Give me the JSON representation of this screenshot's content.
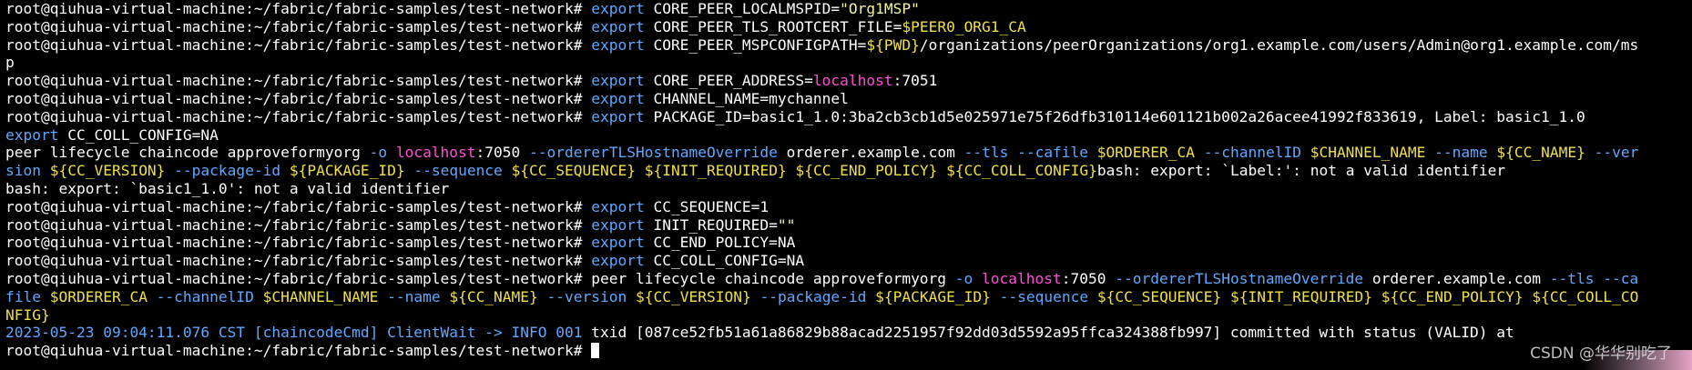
{
  "colors": {
    "default": "#ffffff",
    "cmd": "#5fa8ff",
    "string": "#f5f5a0",
    "var": "#f0e040",
    "host": "#ff4fd8",
    "background": "#000000"
  },
  "prompt": "root@qiuhua-virtual-machine:~/fabric/fabric-samples/test-network# ",
  "lines": [
    [
      {
        "t": "root@qiuhua-virtual-machine:~/fabric/fabric-samples/test-network# ",
        "c": "default"
      },
      {
        "t": "export",
        "c": "cmd"
      },
      {
        "t": " CORE_PEER_LOCALMSPID=",
        "c": "default"
      },
      {
        "t": "\"Org1MSP\"",
        "c": "string"
      }
    ],
    [
      {
        "t": "root@qiuhua-virtual-machine:~/fabric/fabric-samples/test-network# ",
        "c": "default"
      },
      {
        "t": "export",
        "c": "cmd"
      },
      {
        "t": " CORE_PEER_TLS_ROOTCERT_FILE=",
        "c": "default"
      },
      {
        "t": "$PEER0_ORG1_CA",
        "c": "var"
      }
    ],
    [
      {
        "t": "root@qiuhua-virtual-machine:~/fabric/fabric-samples/test-network# ",
        "c": "default"
      },
      {
        "t": "export",
        "c": "cmd"
      },
      {
        "t": " CORE_PEER_MSPCONFIGPATH=",
        "c": "default"
      },
      {
        "t": "${PWD}",
        "c": "var"
      },
      {
        "t": "/organizations/peerOrganizations/org1.example.com/users/Admin@org1.example.com/ms",
        "c": "default"
      }
    ],
    [
      {
        "t": "p",
        "c": "default"
      }
    ],
    [
      {
        "t": "root@qiuhua-virtual-machine:~/fabric/fabric-samples/test-network# ",
        "c": "default"
      },
      {
        "t": "export",
        "c": "cmd"
      },
      {
        "t": " CORE_PEER_ADDRESS=",
        "c": "default"
      },
      {
        "t": "localhost",
        "c": "host"
      },
      {
        "t": ":7051",
        "c": "default"
      }
    ],
    [
      {
        "t": "root@qiuhua-virtual-machine:~/fabric/fabric-samples/test-network# ",
        "c": "default"
      },
      {
        "t": "export",
        "c": "cmd"
      },
      {
        "t": " CHANNEL_NAME=mychannel",
        "c": "default"
      }
    ],
    [
      {
        "t": "root@qiuhua-virtual-machine:~/fabric/fabric-samples/test-network# ",
        "c": "default"
      },
      {
        "t": "export",
        "c": "cmd"
      },
      {
        "t": " PACKAGE_ID=basic1_1.0:3ba2cb3cb1d5e025971e75f26dfb310114e601121b002a26acee41992f833619, Label: basic1_1.0",
        "c": "default"
      }
    ],
    [
      {
        "t": "export",
        "c": "cmd"
      },
      {
        "t": " CC_COLL_CONFIG=NA",
        "c": "default"
      }
    ],
    [
      {
        "t": "peer lifecycle chaincode approveformyorg ",
        "c": "default"
      },
      {
        "t": "-o",
        "c": "cmd"
      },
      {
        "t": " ",
        "c": "default"
      },
      {
        "t": "localhost",
        "c": "host"
      },
      {
        "t": ":7050 ",
        "c": "default"
      },
      {
        "t": "--ordererTLSHostnameOverride",
        "c": "cmd"
      },
      {
        "t": " orderer.example.com ",
        "c": "default"
      },
      {
        "t": "--tls",
        "c": "cmd"
      },
      {
        "t": " ",
        "c": "default"
      },
      {
        "t": "--cafile",
        "c": "cmd"
      },
      {
        "t": " ",
        "c": "default"
      },
      {
        "t": "$ORDERER_CA",
        "c": "var"
      },
      {
        "t": " ",
        "c": "default"
      },
      {
        "t": "--channelID",
        "c": "cmd"
      },
      {
        "t": " ",
        "c": "default"
      },
      {
        "t": "$CHANNEL_NAME",
        "c": "var"
      },
      {
        "t": " ",
        "c": "default"
      },
      {
        "t": "--name",
        "c": "cmd"
      },
      {
        "t": " ",
        "c": "default"
      },
      {
        "t": "${CC_NAME}",
        "c": "var"
      },
      {
        "t": " ",
        "c": "default"
      },
      {
        "t": "--ver",
        "c": "cmd"
      }
    ],
    [
      {
        "t": "sion",
        "c": "cmd"
      },
      {
        "t": " ",
        "c": "default"
      },
      {
        "t": "${CC_VERSION}",
        "c": "var"
      },
      {
        "t": " ",
        "c": "default"
      },
      {
        "t": "--package-id",
        "c": "cmd"
      },
      {
        "t": " ",
        "c": "default"
      },
      {
        "t": "${PACKAGE_ID}",
        "c": "var"
      },
      {
        "t": " ",
        "c": "default"
      },
      {
        "t": "--sequence",
        "c": "cmd"
      },
      {
        "t": " ",
        "c": "default"
      },
      {
        "t": "${CC_SEQUENCE}",
        "c": "var"
      },
      {
        "t": " ",
        "c": "default"
      },
      {
        "t": "${INIT_REQUIRED}",
        "c": "var"
      },
      {
        "t": " ",
        "c": "default"
      },
      {
        "t": "${CC_END_POLICY}",
        "c": "var"
      },
      {
        "t": " ",
        "c": "default"
      },
      {
        "t": "${CC_COLL_CONFIG}",
        "c": "var"
      },
      {
        "t": "bash: export: `Label:': not a valid identifier",
        "c": "default"
      }
    ],
    [
      {
        "t": "bash: export: `basic1_1.0': not a valid identifier",
        "c": "default"
      }
    ],
    [
      {
        "t": "root@qiuhua-virtual-machine:~/fabric/fabric-samples/test-network# ",
        "c": "default"
      },
      {
        "t": "export",
        "c": "cmd"
      },
      {
        "t": " CC_SEQUENCE=1",
        "c": "default"
      }
    ],
    [
      {
        "t": "root@qiuhua-virtual-machine:~/fabric/fabric-samples/test-network# ",
        "c": "default"
      },
      {
        "t": "export",
        "c": "cmd"
      },
      {
        "t": " INIT_REQUIRED=",
        "c": "default"
      },
      {
        "t": "\"\"",
        "c": "string"
      }
    ],
    [
      {
        "t": "root@qiuhua-virtual-machine:~/fabric/fabric-samples/test-network# ",
        "c": "default"
      },
      {
        "t": "export",
        "c": "cmd"
      },
      {
        "t": " CC_END_POLICY=NA",
        "c": "default"
      }
    ],
    [
      {
        "t": "root@qiuhua-virtual-machine:~/fabric/fabric-samples/test-network# ",
        "c": "default"
      },
      {
        "t": "export",
        "c": "cmd"
      },
      {
        "t": " CC_COLL_CONFIG=NA",
        "c": "default"
      }
    ],
    [
      {
        "t": "root@qiuhua-virtual-machine:~/fabric/fabric-samples/test-network# ",
        "c": "default"
      },
      {
        "t": "peer lifecycle chaincode approveformyorg ",
        "c": "default"
      },
      {
        "t": "-o",
        "c": "cmd"
      },
      {
        "t": " ",
        "c": "default"
      },
      {
        "t": "localhost",
        "c": "host"
      },
      {
        "t": ":7050 ",
        "c": "default"
      },
      {
        "t": "--ordererTLSHostnameOverride",
        "c": "cmd"
      },
      {
        "t": " orderer.example.com ",
        "c": "default"
      },
      {
        "t": "--tls",
        "c": "cmd"
      },
      {
        "t": " ",
        "c": "default"
      },
      {
        "t": "--ca",
        "c": "cmd"
      }
    ],
    [
      {
        "t": "file",
        "c": "cmd"
      },
      {
        "t": " ",
        "c": "default"
      },
      {
        "t": "$ORDERER_CA",
        "c": "var"
      },
      {
        "t": " ",
        "c": "default"
      },
      {
        "t": "--channelID",
        "c": "cmd"
      },
      {
        "t": " ",
        "c": "default"
      },
      {
        "t": "$CHANNEL_NAME",
        "c": "var"
      },
      {
        "t": " ",
        "c": "default"
      },
      {
        "t": "--name",
        "c": "cmd"
      },
      {
        "t": " ",
        "c": "default"
      },
      {
        "t": "${CC_NAME}",
        "c": "var"
      },
      {
        "t": " ",
        "c": "default"
      },
      {
        "t": "--version",
        "c": "cmd"
      },
      {
        "t": " ",
        "c": "default"
      },
      {
        "t": "${CC_VERSION}",
        "c": "var"
      },
      {
        "t": " ",
        "c": "default"
      },
      {
        "t": "--package-id",
        "c": "cmd"
      },
      {
        "t": " ",
        "c": "default"
      },
      {
        "t": "${PACKAGE_ID}",
        "c": "var"
      },
      {
        "t": " ",
        "c": "default"
      },
      {
        "t": "--sequence",
        "c": "cmd"
      },
      {
        "t": " ",
        "c": "default"
      },
      {
        "t": "${CC_SEQUENCE}",
        "c": "var"
      },
      {
        "t": " ",
        "c": "default"
      },
      {
        "t": "${INIT_REQUIRED}",
        "c": "var"
      },
      {
        "t": " ",
        "c": "default"
      },
      {
        "t": "${CC_END_POLICY}",
        "c": "var"
      },
      {
        "t": " ",
        "c": "default"
      },
      {
        "t": "${CC_COLL_CO",
        "c": "var"
      }
    ],
    [
      {
        "t": "NFIG}",
        "c": "var"
      }
    ],
    [
      {
        "t": "2023-05-23 09:04:11.076 CST [chaincodeCmd] ClientWait -> INFO 001",
        "c": "cmd"
      },
      {
        "t": " txid [087ce52fb51a61a86829b88acad2251957f92dd03d5592a95ffca324388fb997] committed with status (VALID) at",
        "c": "default"
      }
    ],
    [
      {
        "t": "root@qiuhua-virtual-machine:~/fabric/fabric-samples/test-network# ",
        "c": "default"
      }
    ]
  ],
  "watermark": "CSDN @华华别吃了"
}
